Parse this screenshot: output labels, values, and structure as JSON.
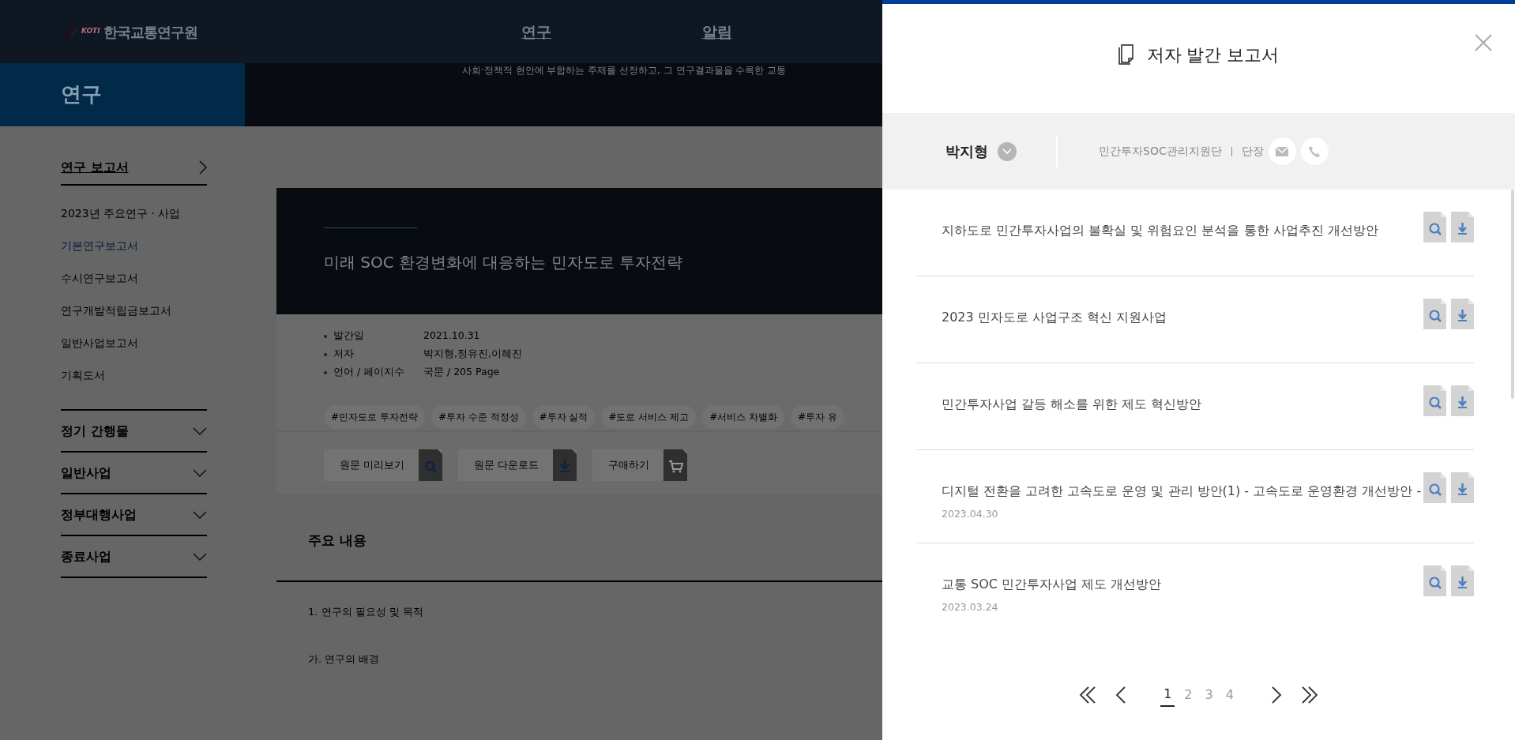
{
  "header": {
    "logo_mark": "KOTI",
    "logo_text": "한국교통연구원",
    "nav": [
      "연구",
      "알림"
    ]
  },
  "banner": {
    "section_title": "연구",
    "description": "사회·정책적 현안에 부합하는 주제를 선정하고, 그 연구결과물을 수록한 교통"
  },
  "sidebar": {
    "heading": "연구 보고서",
    "items": [
      {
        "label": "2023년 주요연구 · 사업",
        "selected": false
      },
      {
        "label": "기본연구보고서",
        "selected": true
      },
      {
        "label": "수시연구보고서",
        "selected": false
      },
      {
        "label": "연구개발적립금보고서",
        "selected": false
      },
      {
        "label": "일반사업보고서",
        "selected": false
      },
      {
        "label": "기획도서",
        "selected": false
      }
    ],
    "groups": [
      {
        "label": "정기 간행물",
        "expanded": false
      },
      {
        "label": "일반사업",
        "expanded": false
      },
      {
        "label": "정부대행사업",
        "expanded": false
      },
      {
        "label": "종료사업",
        "expanded": false
      }
    ]
  },
  "report": {
    "title": "미래 SOC 환경변화에 대응하는 민자도로 투자전략",
    "meta": [
      {
        "label": "발간일",
        "value": "2021.10.31"
      },
      {
        "label": "저자",
        "value": "박지형,정유진,이혜진"
      },
      {
        "label": "언어 / 페이지수",
        "value": "국문 / 205 Page"
      }
    ],
    "tags": [
      "#민자도로 투자전략",
      "#투자 수준 적정성",
      "#투자 실적",
      "#도로 서비스 제고",
      "#서비스 차별화",
      "#투자 유"
    ],
    "actions": [
      {
        "label": "원문 미리보기",
        "kind": "preview"
      },
      {
        "label": "원문 다운로드",
        "kind": "download"
      },
      {
        "label": "구매하기",
        "kind": "purchase"
      }
    ]
  },
  "contents": {
    "heading": "주요 내용",
    "lines": [
      "1. 연구의 필요성 및 목적",
      "가. 연구의 배경"
    ]
  },
  "panel": {
    "title": "저자 발간 보고서",
    "author": {
      "name": "박지형",
      "department": "민간투자SOC관리지원단",
      "position": "단장"
    },
    "reports": [
      {
        "title": "지하도로 민간투자사업의 불확실 및 위험요인 분석을 통한 사업추진 개선방안"
      },
      {
        "title": "2023 민자도로 사업구조 혁신 지원사업"
      },
      {
        "title": "민간투자사업 갈등 해소를 위한 제도 혁신방안"
      },
      {
        "title": "디지털 전환을 고려한 고속도로 운영 및 관리 방안(1) - 고속도로 운영환경 개선방안 -",
        "date": "2023.04.30"
      },
      {
        "title": "교통 SOC 민간투자사업 제도 개선방안",
        "date": "2023.03.24"
      }
    ],
    "pagination": [
      {
        "label": "1",
        "selected": true
      },
      {
        "label": "2",
        "selected": false
      },
      {
        "label": "3",
        "selected": false
      },
      {
        "label": "4",
        "selected": false
      }
    ]
  }
}
